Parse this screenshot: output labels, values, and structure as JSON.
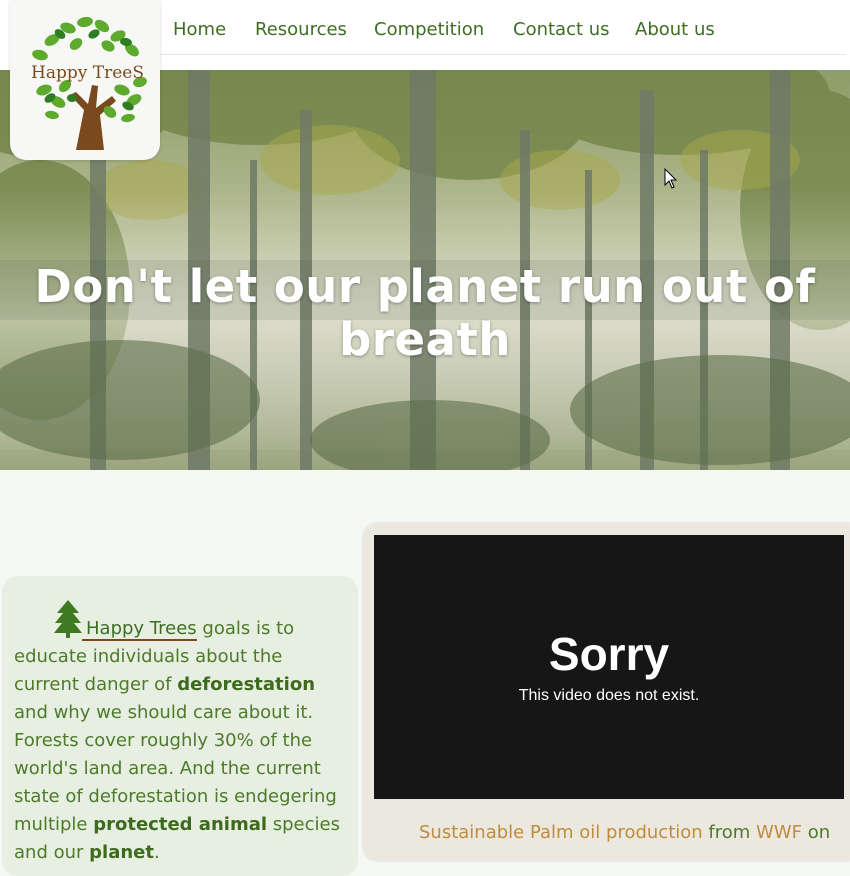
{
  "logo": {
    "text": "Happy TreeS"
  },
  "nav": {
    "items": [
      "Home",
      "Resources",
      "Competition",
      "Contact us",
      "About us"
    ]
  },
  "hero": {
    "title": "Don't let our planet run out of breath"
  },
  "info": {
    "link_label": "Happy Trees",
    "t1": " goals is to educate individuals about the current danger of ",
    "b1": "deforestation",
    "t2": " and why we should care about it. Forests cover roughly 30% of the world's land area. And the current state of deforestation is endegering multiple ",
    "b2": "protected animal",
    "t3": " species and our ",
    "b3": "planet",
    "t4": "."
  },
  "video": {
    "title": "Sorry",
    "message": "This video does not exist.",
    "caption_link": "Sustainable Palm oil production",
    "caption_mid": " from ",
    "caption_org": "WWF",
    "caption_end": " on"
  },
  "colors": {
    "nav_text": "#3e6e22",
    "accent_brown": "#7a4a1e",
    "gold": "#c08b3c",
    "info_bg": "#e6efe1"
  }
}
